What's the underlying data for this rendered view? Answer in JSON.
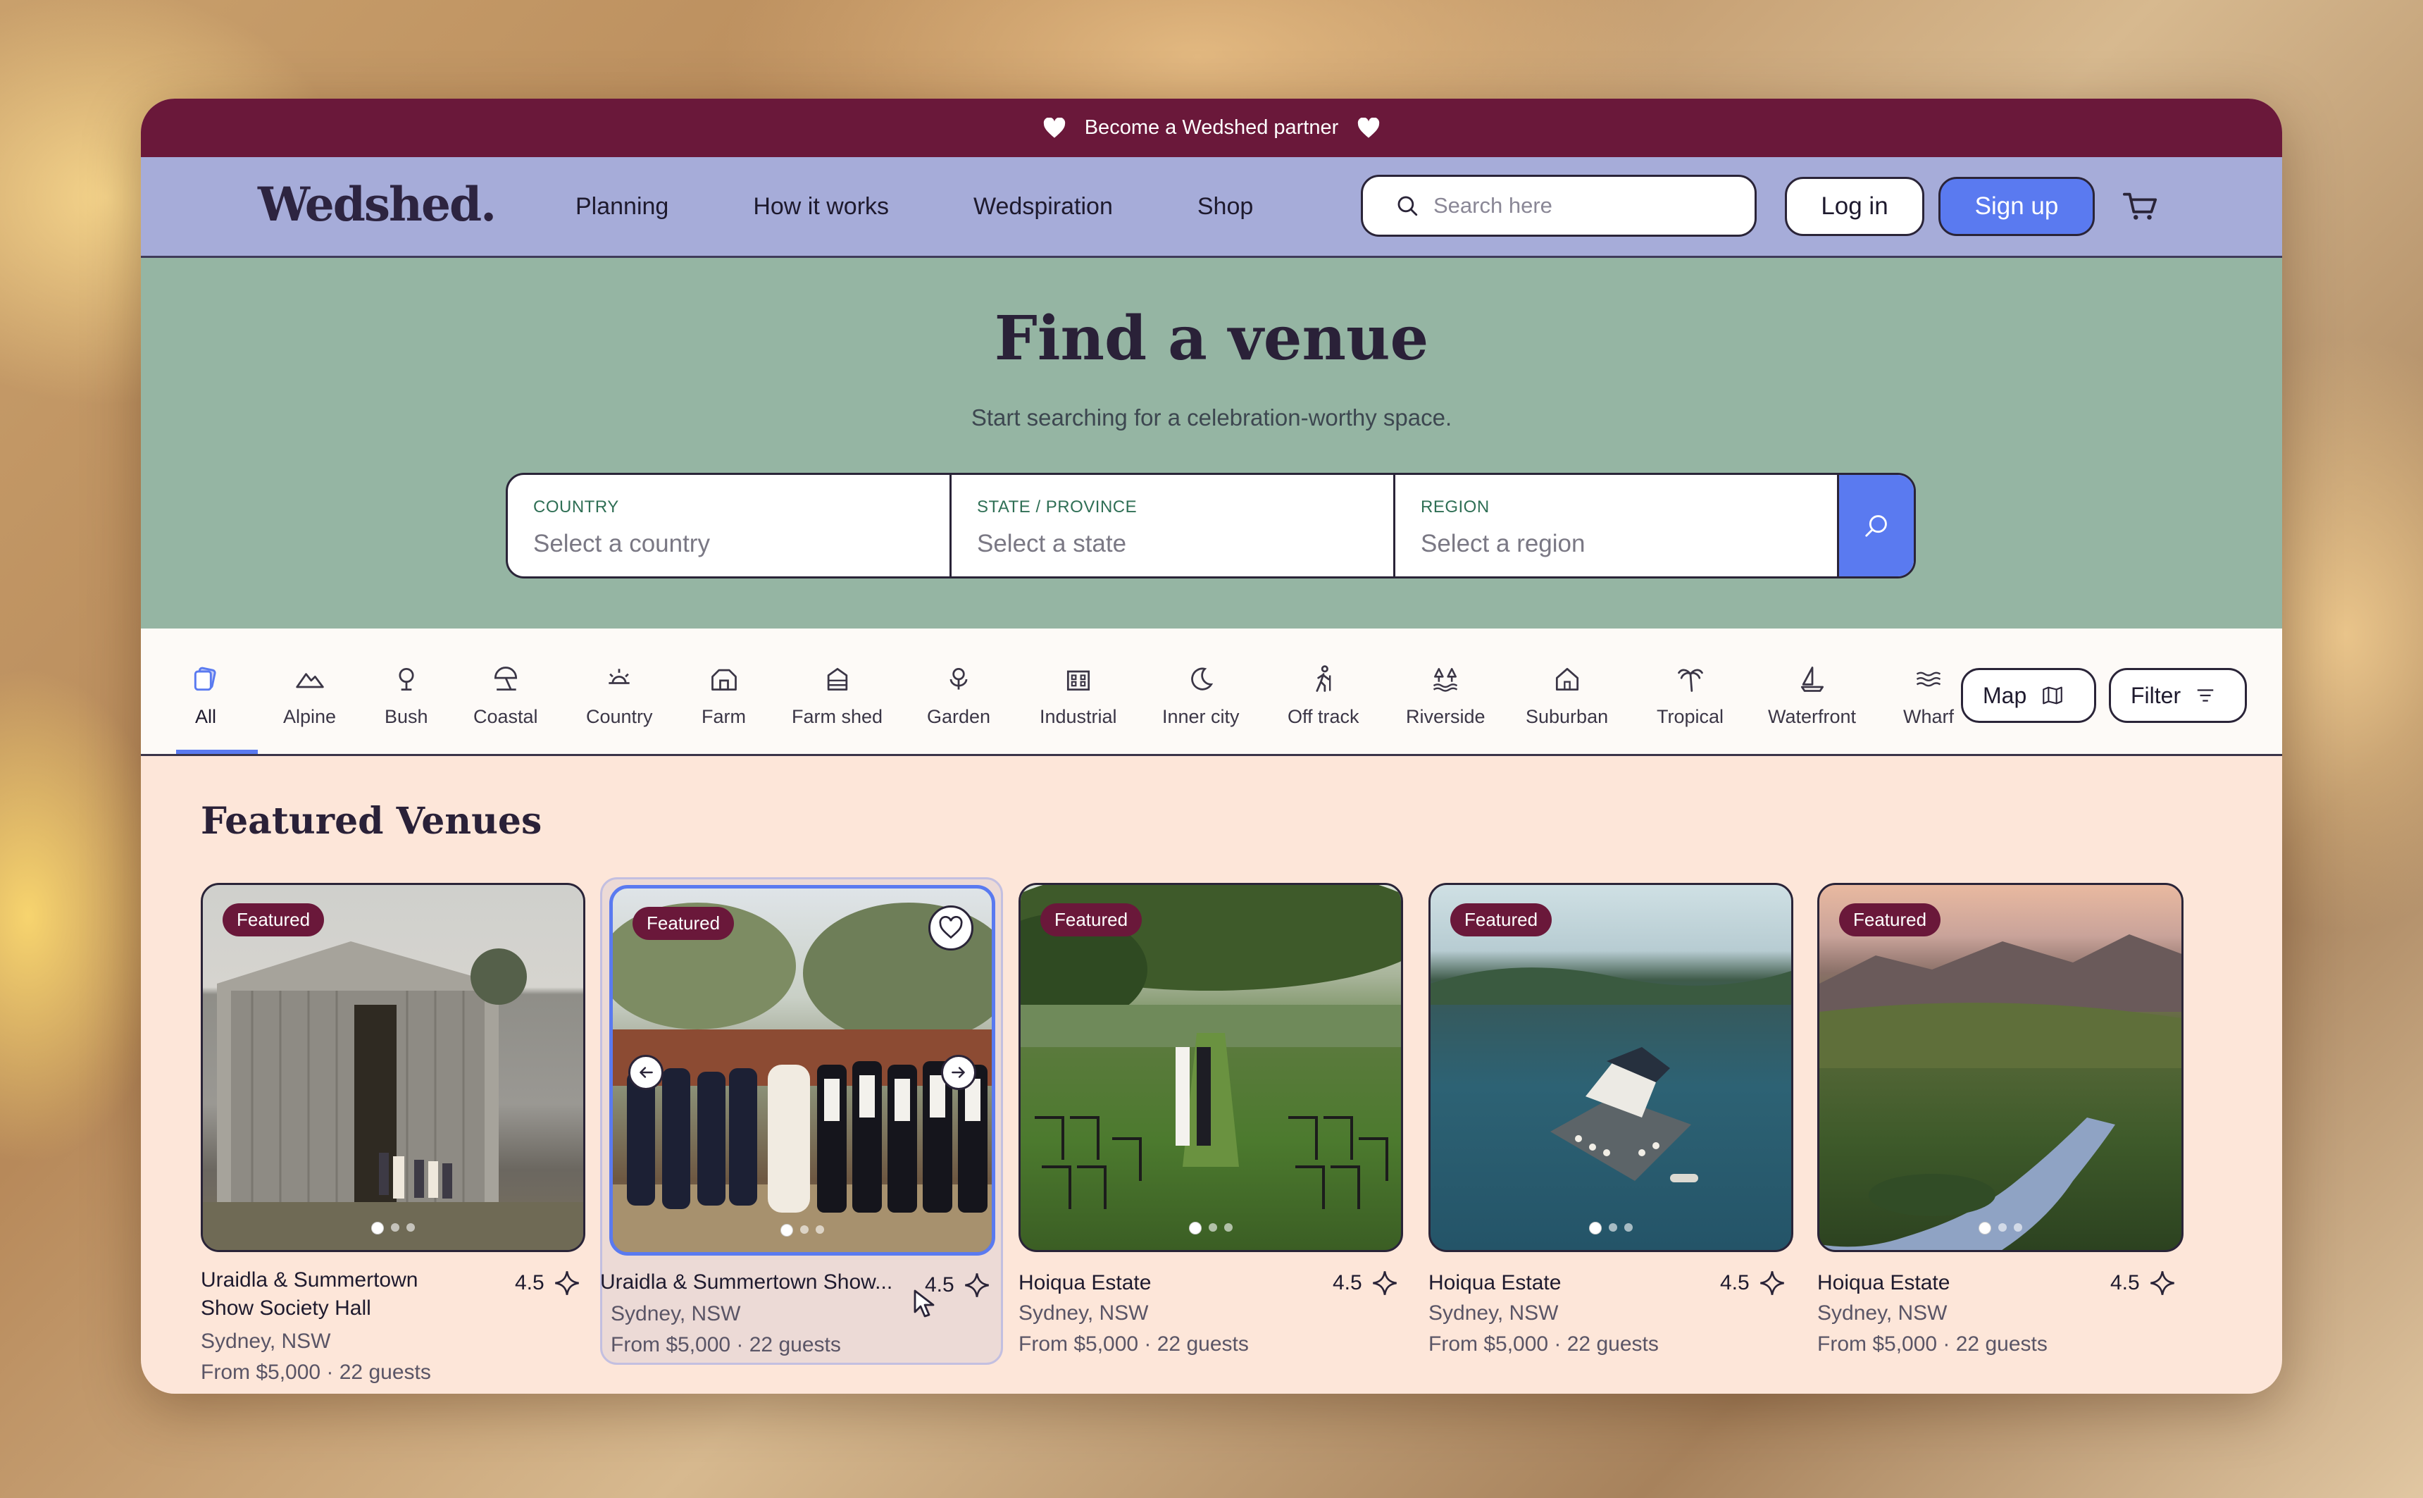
{
  "promo": {
    "text": "Become a Wedshed partner"
  },
  "header": {
    "logo": "Wedshed.",
    "nav": [
      "Planning",
      "How it works",
      "Wedspiration",
      "Shop"
    ],
    "search_placeholder": "Search here",
    "login_label": "Log in",
    "signup_label": "Sign up"
  },
  "hero": {
    "title": "Find a venue",
    "subtitle": "Start searching for a celebration-worthy space.",
    "fields": [
      {
        "label": "COUNTRY",
        "placeholder": "Select a country"
      },
      {
        "label": "STATE / PROVINCE",
        "placeholder": "Select a state"
      },
      {
        "label": "REGION",
        "placeholder": "Select a region"
      }
    ]
  },
  "categories": [
    {
      "label": "All",
      "icon": "all-icon"
    },
    {
      "label": "Alpine",
      "icon": "mountain-icon"
    },
    {
      "label": "Bush",
      "icon": "tree-icon"
    },
    {
      "label": "Coastal",
      "icon": "beach-umbrella-icon"
    },
    {
      "label": "Country",
      "icon": "sun-icon"
    },
    {
      "label": "Farm",
      "icon": "barn-icon"
    },
    {
      "label": "Farm shed",
      "icon": "shed-icon"
    },
    {
      "label": "Garden",
      "icon": "flower-icon"
    },
    {
      "label": "Industrial",
      "icon": "factory-icon"
    },
    {
      "label": "Inner city",
      "icon": "moon-icon"
    },
    {
      "label": "Off track",
      "icon": "hiker-icon"
    },
    {
      "label": "Riverside",
      "icon": "trees-icon"
    },
    {
      "label": "Suburban",
      "icon": "house-icon"
    },
    {
      "label": "Tropical",
      "icon": "palm-icon"
    },
    {
      "label": "Waterfront",
      "icon": "sailboat-icon"
    },
    {
      "label": "Wharf",
      "icon": "waves-icon"
    }
  ],
  "controls": {
    "map_label": "Map",
    "filter_label": "Filter"
  },
  "featured": {
    "title": "Featured Venues",
    "badge": "Featured",
    "cards": [
      {
        "name_l1": "Uraidla & Summertown",
        "name_l2": "Show Society Hall",
        "rating": "4.5",
        "location": "Sydney, NSW",
        "price": "From $5,000 · 22 guests"
      },
      {
        "name_l1": "Uraidla & Summertown Show...",
        "rating": "4.5",
        "location": "Sydney, NSW",
        "price": "From $5,000 · 22 guests"
      },
      {
        "name_l1": "Hoiqua Estate",
        "rating": "4.5",
        "location": "Sydney, NSW",
        "price": "From $5,000 · 22 guests"
      },
      {
        "name_l1": "Hoiqua Estate",
        "rating": "4.5",
        "location": "Sydney, NSW",
        "price": "From $5,000 · 22 guests"
      },
      {
        "name_l1": "Hoiqua Estate",
        "rating": "4.5",
        "location": "Sydney, NSW",
        "price": "From $5,000 · 22 guests"
      }
    ]
  },
  "colors": {
    "brand": "#6a183a",
    "accent": "#5a7af0",
    "header_bg": "#a6acd9",
    "hero_bg": "#95b5a3",
    "section_bg": "#fde6d9"
  }
}
